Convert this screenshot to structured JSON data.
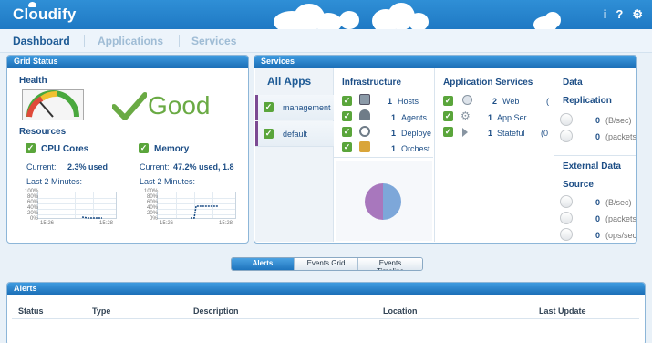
{
  "app": {
    "logo_text": "Cloudify",
    "colors": {
      "topbar": "#1f79c4",
      "ok_green": "#5aa53b",
      "good_text": "#6aaa44",
      "nav_active": "#1d5a95",
      "accent_purple": "#7b4a93"
    }
  },
  "topbar": {
    "icons": [
      "info-icon",
      "help-icon",
      "settings-icon"
    ],
    "info_glyph": "i",
    "help_glyph": "?",
    "settings_glyph": "⚙"
  },
  "nav": {
    "tabs": [
      {
        "label": "Dashboard",
        "active": true
      },
      {
        "label": "Applications"
      },
      {
        "label": "Services"
      }
    ]
  },
  "grid_status": {
    "title": "Grid Status",
    "health": {
      "label": "Health",
      "status": "Good"
    },
    "resources": {
      "label": "Resources",
      "cpu": {
        "label": "CPU Cores",
        "current_label": "Current:",
        "current_value": "2.3% used",
        "period": "Last 2 Minutes:",
        "y_ticks": [
          "100%",
          "80%",
          "60%",
          "40%",
          "20%",
          "0%"
        ],
        "x_ticks": [
          "15:26",
          "15:28"
        ]
      },
      "memory": {
        "label": "Memory",
        "current_label": "Current:",
        "current_value": "47.2% used, 1.8",
        "period": "Last 2 Minutes:",
        "y_ticks": [
          "100%",
          "80%",
          "60%",
          "40%",
          "20%",
          "0%"
        ],
        "x_ticks": [
          "15:26",
          "15:28"
        ]
      }
    }
  },
  "services": {
    "title": "Services",
    "apps_title": "All Apps",
    "apps": [
      "management",
      "default"
    ],
    "infrastructure": {
      "title": "Infrastructure",
      "rows": [
        {
          "count": "1",
          "label": "Hosts"
        },
        {
          "count": "1",
          "label": "Agents"
        },
        {
          "count": "1",
          "label": "Deploye"
        },
        {
          "count": "1",
          "label": "Orchest"
        }
      ]
    },
    "application_services": {
      "title": "Application Services",
      "rows": [
        {
          "count": "2",
          "label": "Web",
          "extra": "("
        },
        {
          "count": "1",
          "label": "App Ser...",
          "extra": ""
        },
        {
          "count": "1",
          "label": "Stateful",
          "extra": "(0"
        }
      ]
    },
    "data_replication": {
      "title_line1": "Data",
      "title_line2": "Replication",
      "rows": [
        {
          "count": "0",
          "unit": "(B/sec)"
        },
        {
          "count": "0",
          "unit": "(packets"
        }
      ]
    },
    "external_data_source": {
      "title_line1": "External Data",
      "title_line2": "Source",
      "rows": [
        {
          "count": "0",
          "unit": "(B/sec)"
        },
        {
          "count": "0",
          "unit": "(packets"
        },
        {
          "count": "0",
          "unit": "(ops/sec"
        }
      ]
    }
  },
  "bottom_tabs": [
    {
      "label": "Alerts",
      "selected": true
    },
    {
      "label": "Events Grid"
    },
    {
      "label": "Events Timeline"
    }
  ],
  "alerts": {
    "title": "Alerts",
    "columns": [
      "Status",
      "Type",
      "Description",
      "Location",
      "Last Update"
    ]
  }
}
